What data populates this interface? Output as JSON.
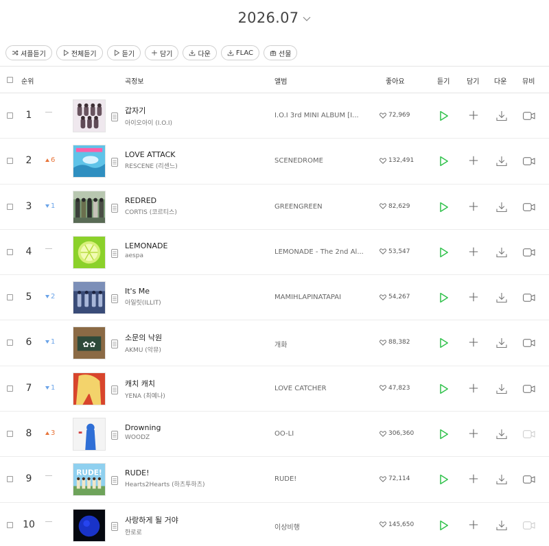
{
  "period": {
    "label": "2026.07"
  },
  "toolbar": [
    {
      "key": "shuffle",
      "label": "셔플듣기",
      "icon": "shuffle-icon"
    },
    {
      "key": "play-all",
      "label": "전체듣기",
      "icon": "play-icon"
    },
    {
      "key": "listen",
      "label": "듣기",
      "icon": "play-icon"
    },
    {
      "key": "add",
      "label": "담기",
      "icon": "plus-icon"
    },
    {
      "key": "download",
      "label": "다운",
      "icon": "download-icon"
    },
    {
      "key": "flac",
      "label": "FLAC",
      "icon": "download-icon"
    },
    {
      "key": "gift",
      "label": "선물",
      "icon": "gift-icon"
    }
  ],
  "header": {
    "rank": "순위",
    "song_info": "곡정보",
    "album": "앨범",
    "likes": "좋아요",
    "listen": "듣기",
    "add": "담기",
    "download": "다운",
    "mv": "뮤비"
  },
  "colors": {
    "accent": "#2fc14a",
    "up": "#e8753a",
    "down": "#6aa3e8"
  },
  "rows": [
    {
      "rank": "1",
      "change": {
        "dir": "same",
        "value": ""
      },
      "title": "갑자기",
      "artist": "아이오아이 (I.O.I)",
      "album": "I.O.I 3rd MINI ALBUM [I...",
      "likes": "72,969",
      "mv_available": true
    },
    {
      "rank": "2",
      "change": {
        "dir": "up",
        "value": "6"
      },
      "title": "LOVE ATTACK",
      "artist": "RESCENE (리센느)",
      "album": "SCENEDROME",
      "likes": "132,491",
      "mv_available": true
    },
    {
      "rank": "3",
      "change": {
        "dir": "down",
        "value": "1"
      },
      "title": "REDRED",
      "artist": "CORTIS (코르티스)",
      "album": "GREENGREEN",
      "likes": "82,629",
      "mv_available": true
    },
    {
      "rank": "4",
      "change": {
        "dir": "same",
        "value": ""
      },
      "title": "LEMONADE",
      "artist": "aespa",
      "album": "LEMONADE - The 2nd Al...",
      "likes": "53,547",
      "mv_available": true
    },
    {
      "rank": "5",
      "change": {
        "dir": "down",
        "value": "2"
      },
      "title": "It's Me",
      "artist": "아일릿(ILLIT)",
      "album": "MAMIHLAPINATAPAI",
      "likes": "54,267",
      "mv_available": true
    },
    {
      "rank": "6",
      "change": {
        "dir": "down",
        "value": "1"
      },
      "title": "소문의 낙원",
      "artist": "AKMU (악뮤)",
      "album": "개화",
      "likes": "88,382",
      "mv_available": true
    },
    {
      "rank": "7",
      "change": {
        "dir": "down",
        "value": "1"
      },
      "title": "캐치 캐치",
      "artist": "YENA (최예나)",
      "album": "LOVE CATCHER",
      "likes": "47,823",
      "mv_available": true
    },
    {
      "rank": "8",
      "change": {
        "dir": "up",
        "value": "3"
      },
      "title": "Drowning",
      "artist": "WOODZ",
      "album": "OO-LI",
      "likes": "306,360",
      "mv_available": false
    },
    {
      "rank": "9",
      "change": {
        "dir": "same",
        "value": ""
      },
      "title": "RUDE!",
      "artist": "Hearts2Hearts (하츠투하츠)",
      "album": "RUDE!",
      "likes": "72,114",
      "mv_available": true
    },
    {
      "rank": "10",
      "change": {
        "dir": "same",
        "value": ""
      },
      "title": "사랑하게 될 거야",
      "artist": "한로로",
      "album": "이상비행",
      "likes": "145,650",
      "mv_available": false
    }
  ]
}
